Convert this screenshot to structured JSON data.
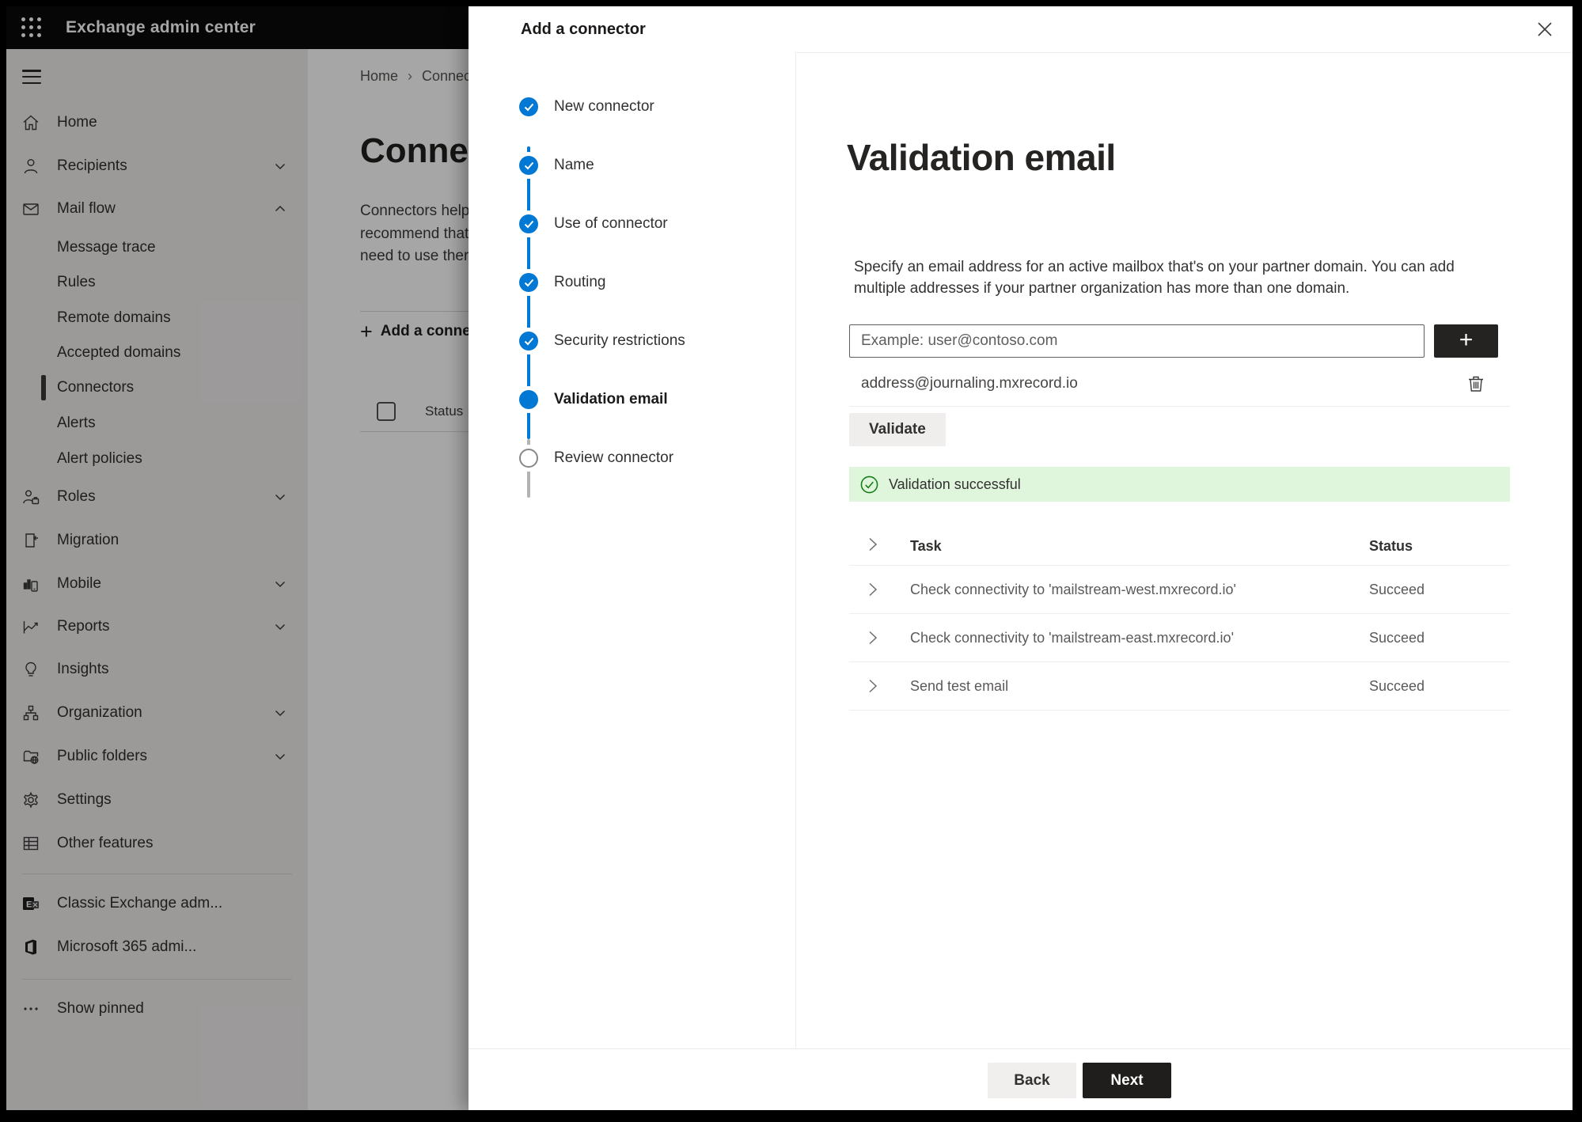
{
  "topbar": {
    "title": "Exchange admin center"
  },
  "sidebar": {
    "items": [
      {
        "label": "Home",
        "icon": "home-icon"
      },
      {
        "label": "Recipients",
        "icon": "person-icon",
        "chevron": "down"
      },
      {
        "label": "Mail flow",
        "icon": "mail-icon",
        "chevron": "up"
      },
      {
        "label": "Message trace",
        "sub": true
      },
      {
        "label": "Rules",
        "sub": true
      },
      {
        "label": "Remote domains",
        "sub": true
      },
      {
        "label": "Accepted domains",
        "sub": true
      },
      {
        "label": "Connectors",
        "sub": true,
        "selected": true
      },
      {
        "label": "Alerts",
        "sub": true
      },
      {
        "label": "Alert policies",
        "sub": true
      },
      {
        "label": "Roles",
        "icon": "roles-icon",
        "chevron": "down"
      },
      {
        "label": "Migration",
        "icon": "migration-icon"
      },
      {
        "label": "Mobile",
        "icon": "mobile-icon",
        "chevron": "down"
      },
      {
        "label": "Reports",
        "icon": "reports-icon",
        "chevron": "down"
      },
      {
        "label": "Insights",
        "icon": "lightbulb-icon"
      },
      {
        "label": "Organization",
        "icon": "org-icon",
        "chevron": "down"
      },
      {
        "label": "Public folders",
        "icon": "folder-globe-icon",
        "chevron": "down"
      },
      {
        "label": "Settings",
        "icon": "gear-icon"
      },
      {
        "label": "Other features",
        "icon": "table-icon"
      },
      {
        "divider": true
      },
      {
        "label": "Classic Exchange adm...",
        "icon": "exchange-logo-icon"
      },
      {
        "label": "Microsoft 365 admi...",
        "icon": "office-logo-icon"
      },
      {
        "divider": true
      },
      {
        "label": "Show pinned",
        "icon": "ellipsis-icon"
      }
    ]
  },
  "page": {
    "breadcrumb": [
      "Home",
      "Connectors"
    ],
    "breadcrumb_separator": "›",
    "title": "Connectors",
    "intro_lines": [
      "Connectors help",
      "recommend that",
      "need to use ther"
    ],
    "add_button_label": "Add a connector",
    "status_header": "Status"
  },
  "panel": {
    "title": "Add a connector",
    "steps": [
      {
        "label": "New connector",
        "state": "done"
      },
      {
        "label": "Name",
        "state": "done"
      },
      {
        "label": "Use of connector",
        "state": "done"
      },
      {
        "label": "Routing",
        "state": "done"
      },
      {
        "label": "Security restrictions",
        "state": "done"
      },
      {
        "label": "Validation email",
        "state": "current"
      },
      {
        "label": "Review connector",
        "state": "upcoming"
      }
    ],
    "content": {
      "heading": "Validation email",
      "description": "Specify an email address for an active mailbox that's on your partner domain. You can add multiple addresses if your partner organization has more than one domain.",
      "email_input": {
        "value": "",
        "placeholder": "Example: user@contoso.com"
      },
      "addresses": [
        {
          "email": "address@journaling.mxrecord.io"
        }
      ],
      "validate_button_label": "Validate",
      "banner": {
        "text": "Validation successful"
      },
      "tasks": {
        "columns": [
          "Task",
          "Status"
        ],
        "rows": [
          {
            "task": "Check connectivity to 'mailstream-west.mxrecord.io'",
            "status": "Succeed"
          },
          {
            "task": "Check connectivity to 'mailstream-east.mxrecord.io'",
            "status": "Succeed"
          },
          {
            "task": "Send test email",
            "status": "Succeed"
          }
        ]
      }
    },
    "footer": {
      "back_label": "Back",
      "next_label": "Next"
    }
  },
  "colors": {
    "accent_blue": "#0078d4",
    "success_banner_bg": "#dff6dd",
    "success_green": "#107c10",
    "primary_button_bg": "#1f1e1d",
    "topbar_bg": "#0a0a0a"
  }
}
